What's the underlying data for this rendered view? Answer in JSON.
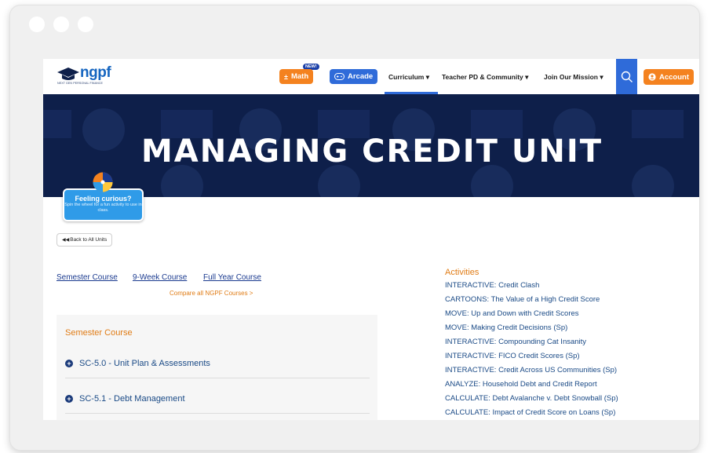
{
  "header": {
    "logo_text": "ngpf",
    "logo_sub": "NEXT GEN PERSONAL FINANCE",
    "math_label": "Math",
    "new_badge": "NEW!",
    "arcade_label": "Arcade",
    "nav": [
      "Curriculum",
      "Teacher PD & Community",
      "Join Our Mission"
    ],
    "account_label": "Account"
  },
  "banner": {
    "title": "MANAGING CREDIT UNIT"
  },
  "curious": {
    "title": "Feeling curious?",
    "subtitle": "Spin the wheel for a fun activity to use in class."
  },
  "back_label": "Back to All Units",
  "course_links": [
    "Semester Course",
    "9-Week Course",
    "Full Year Course"
  ],
  "compare_label": "Compare all NGPF Courses >",
  "panel": {
    "title": "Semester Course",
    "units": [
      "SC-5.0 - Unit Plan & Assessments",
      "SC-5.1 - Debt Management"
    ]
  },
  "activities": {
    "title": "Activities",
    "items": [
      "INTERACTIVE: Credit Clash",
      "CARTOONS: The Value of a High Credit Score",
      "MOVE: Up and Down with Credit Scores",
      "MOVE: Making Credit Decisions (Sp)",
      "INTERACTIVE: Compounding Cat Insanity",
      "INTERACTIVE: FICO Credit Scores (Sp)",
      "INTERACTIVE: Credit Across US Communities (Sp)",
      "ANALYZE: Household Debt and Credit Report",
      "CALCULATE: Debt Avalanche v. Debt Snowball (Sp)",
      "CALCULATE: Impact of Credit Score on Loans (Sp)"
    ]
  },
  "colors": {
    "brand_blue": "#2f6bd9",
    "orange": "#f4821f",
    "navy": "#0e1f4a",
    "link": "#1a4a86"
  }
}
